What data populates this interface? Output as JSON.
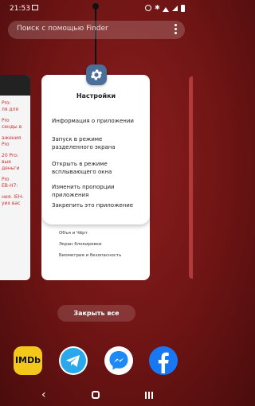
{
  "status_bar": {
    "time": "21:53"
  },
  "search": {
    "placeholder": "Поиск с помощью Finder"
  },
  "popup": {
    "title": "Настройки",
    "items": [
      "Информация о приложении",
      "Запуск в режиме разделенного экрана",
      "Открыть в режиме всплывающего окна",
      "Изменить пропорции приложения",
      "Закрепить это приложение"
    ]
  },
  "background_app": {
    "list": [
      "Объя и Чёрт",
      "Экран блокировки",
      "Биометрия и безопасность"
    ],
    "left_card_text": [
      "Pro:",
      "ля для",
      "Pro",
      "сенды в",
      "ажения",
      "Pro",
      "20 Pro:",
      "вые деньги",
      "Pro",
      "ЕВ-H7:",
      "ния. IEH-",
      "уих вас"
    ]
  },
  "close_all_label": "Закрыть все",
  "dock": {
    "apps": [
      {
        "name": "IMDb",
        "icon": "imdb-icon"
      },
      {
        "name": "Telegram",
        "icon": "telegram-icon"
      },
      {
        "name": "Messenger",
        "icon": "messenger-icon"
      },
      {
        "name": "Facebook",
        "icon": "facebook-icon"
      }
    ],
    "imdb_label": "IMDb"
  },
  "colors": {
    "background": "#6e1414",
    "gear_bg": "#4a6f99",
    "facebook": "#1877f2"
  }
}
